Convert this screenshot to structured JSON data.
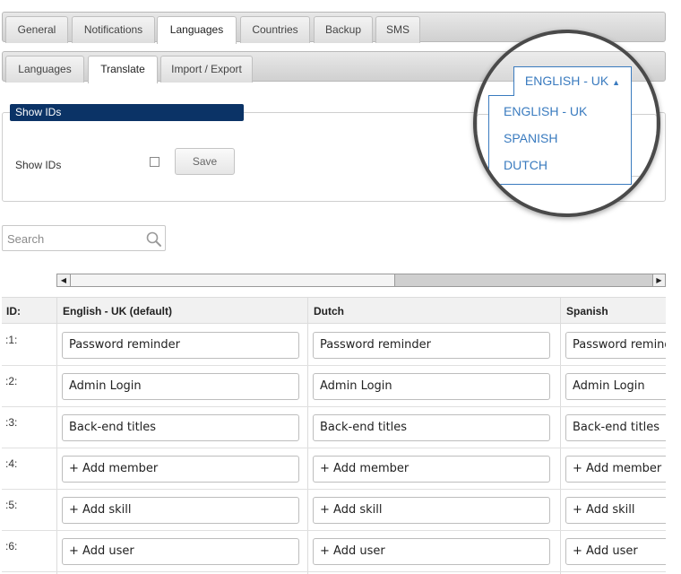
{
  "main_tabs": [
    {
      "label": "General"
    },
    {
      "label": "Notifications"
    },
    {
      "label": "Languages"
    },
    {
      "label": "Countries"
    },
    {
      "label": "Backup"
    },
    {
      "label": "SMS"
    }
  ],
  "main_tabs_active": "Languages",
  "sub_tabs": [
    {
      "label": "Languages"
    },
    {
      "label": "Translate"
    },
    {
      "label": "Import / Export"
    }
  ],
  "sub_tabs_active": "Translate",
  "show_ids": {
    "legend": "Show IDs",
    "label": "Show IDs",
    "checked": false,
    "save_label": "Save"
  },
  "search": {
    "placeholder": "Search"
  },
  "language_dropdown": {
    "selected": "ENGLISH - UK",
    "options": [
      "ENGLISH - UK",
      "SPANISH",
      "DUTCH"
    ]
  },
  "grid": {
    "columns": [
      "ID:",
      "English - UK (default)",
      "Dutch",
      "Spanish"
    ],
    "rows": [
      {
        "id": ":1:",
        "english": "Password reminder",
        "dutch": "Password reminder",
        "spanish": "Password reminder"
      },
      {
        "id": ":2:",
        "english": "Admin Login",
        "dutch": "Admin Login",
        "spanish": "Admin Login"
      },
      {
        "id": ":3:",
        "english": "Back-end titles",
        "dutch": "Back-end titles",
        "spanish": "Back-end titles"
      },
      {
        "id": ":4:",
        "english": "+ Add member",
        "dutch": "+ Add member",
        "spanish": "+ Add member"
      },
      {
        "id": ":5:",
        "english": "+ Add skill",
        "dutch": "+ Add skill",
        "spanish": "+ Add skill"
      },
      {
        "id": ":6:",
        "english": "+ Add user",
        "dutch": "+ Add user",
        "spanish": "+ Add user"
      }
    ]
  },
  "colors": {
    "legend_bg": "#0b3366",
    "link_blue": "#3a7bbf"
  }
}
